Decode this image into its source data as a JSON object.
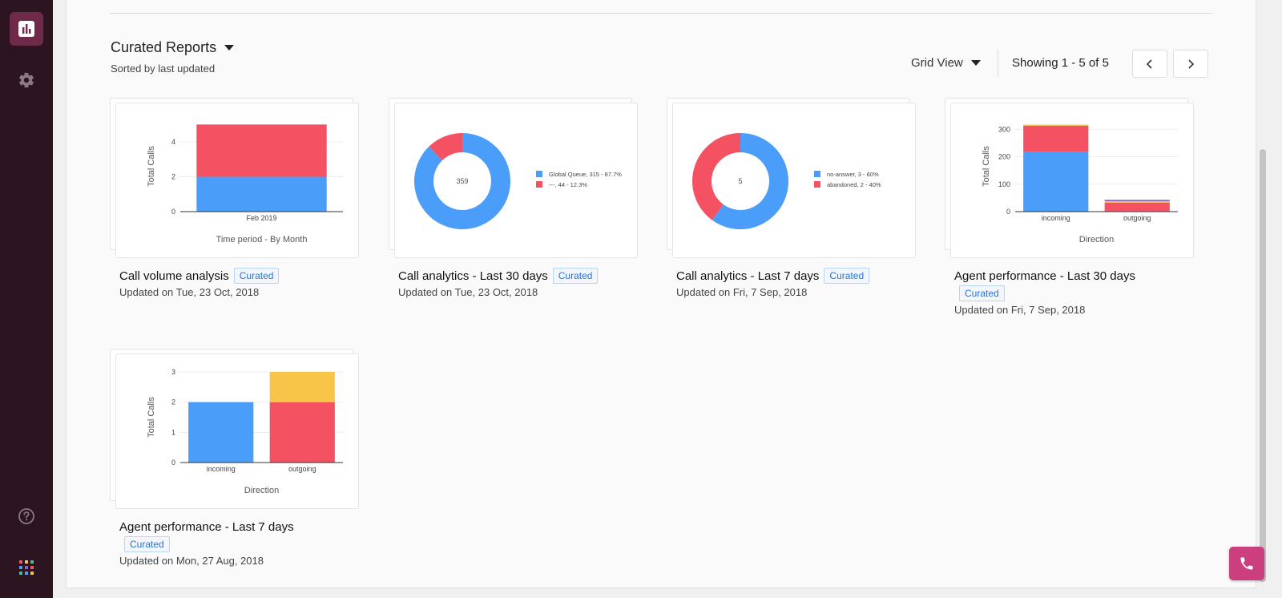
{
  "sidebar": {
    "items": [
      {
        "icon": "bar-chart-icon",
        "active": true
      },
      {
        "icon": "gear-icon",
        "active": false
      }
    ],
    "bottom": [
      {
        "icon": "help-icon"
      },
      {
        "icon": "apps-grid-icon"
      }
    ]
  },
  "header": {
    "title": "Curated Reports",
    "subtitle": "Sorted by last updated",
    "view_label": "Grid View",
    "showing": "Showing 1 - 5 of 5"
  },
  "colors": {
    "blue": "#4a9df8",
    "red": "#f45162",
    "yellow": "#f8c548",
    "purple": "#8a63c9",
    "accent": "#cc3f7e",
    "sidebar": "#2d1421"
  },
  "cards": [
    {
      "name": "Call volume analysis",
      "badge": "Curated",
      "updated": "Updated on Tue, 23 Oct, 2018",
      "chart_data": {
        "type": "bar",
        "stacked": true,
        "categories": [
          "Feb 2019"
        ],
        "series": [
          {
            "color": "#4a9df8",
            "values": [
              2
            ]
          },
          {
            "color": "#f45162",
            "values": [
              3
            ]
          }
        ],
        "ylabel": "Total Calls",
        "xlabel": "Time period - By Month",
        "yticks": [
          "0",
          "2",
          "4"
        ],
        "ylim": [
          0,
          5.2
        ]
      }
    },
    {
      "name": "Call analytics - Last 30 days",
      "badge": "Curated",
      "updated": "Updated on Tue, 23 Oct, 2018",
      "chart_data": {
        "type": "pie",
        "donut": true,
        "center": "359",
        "slices": [
          {
            "label": "Global Queue",
            "legend": "315 - 87.7%",
            "value": 315,
            "color": "#4a9df8"
          },
          {
            "label": "---",
            "legend": "44 - 12.3%",
            "value": 44,
            "color": "#f45162"
          }
        ]
      }
    },
    {
      "name": "Call analytics - Last 7 days",
      "badge": "Curated",
      "updated": "Updated on Fri, 7 Sep, 2018",
      "chart_data": {
        "type": "pie",
        "donut": true,
        "center": "5",
        "slices": [
          {
            "label": "no-answer",
            "legend": "3 - 60%",
            "value": 3,
            "color": "#4a9df8"
          },
          {
            "label": "abandoned",
            "legend": "2 - 40%",
            "value": 2,
            "color": "#f45162"
          }
        ]
      }
    },
    {
      "name": "Agent performance - Last 30 days",
      "badge": "Curated",
      "updated": "Updated on Fri, 7 Sep, 2018",
      "chart_data": {
        "type": "bar",
        "stacked": true,
        "categories": [
          "incoming",
          "outgoing"
        ],
        "series": [
          {
            "color": "#4a9df8",
            "values": [
              218,
              3
            ]
          },
          {
            "color": "#f45162",
            "values": [
              95,
              30
            ]
          },
          {
            "color": "#f8c548",
            "values": [
              4,
              5
            ]
          },
          {
            "color": "#8a63c9",
            "values": [
              0,
              5
            ]
          }
        ],
        "ylabel": "Total Calls",
        "xlabel": "Direction",
        "yticks": [
          "0",
          "100",
          "200",
          "300"
        ],
        "ylim": [
          0,
          330
        ]
      }
    },
    {
      "name": "Agent performance - Last 7 days",
      "badge": "Curated",
      "updated": "Updated on Mon, 27 Aug, 2018",
      "chart_data": {
        "type": "bar",
        "stacked": true,
        "categories": [
          "incoming",
          "outgoing"
        ],
        "series": [
          {
            "color": "#4a9df8",
            "values": [
              2,
              0
            ]
          },
          {
            "color": "#f45162",
            "values": [
              0,
              2
            ]
          },
          {
            "color": "#f8c548",
            "values": [
              0,
              1
            ]
          }
        ],
        "ylabel": "Total Calls",
        "xlabel": "Direction",
        "yticks": [
          "0",
          "1",
          "2",
          "3"
        ],
        "ylim": [
          0,
          3
        ]
      }
    }
  ]
}
